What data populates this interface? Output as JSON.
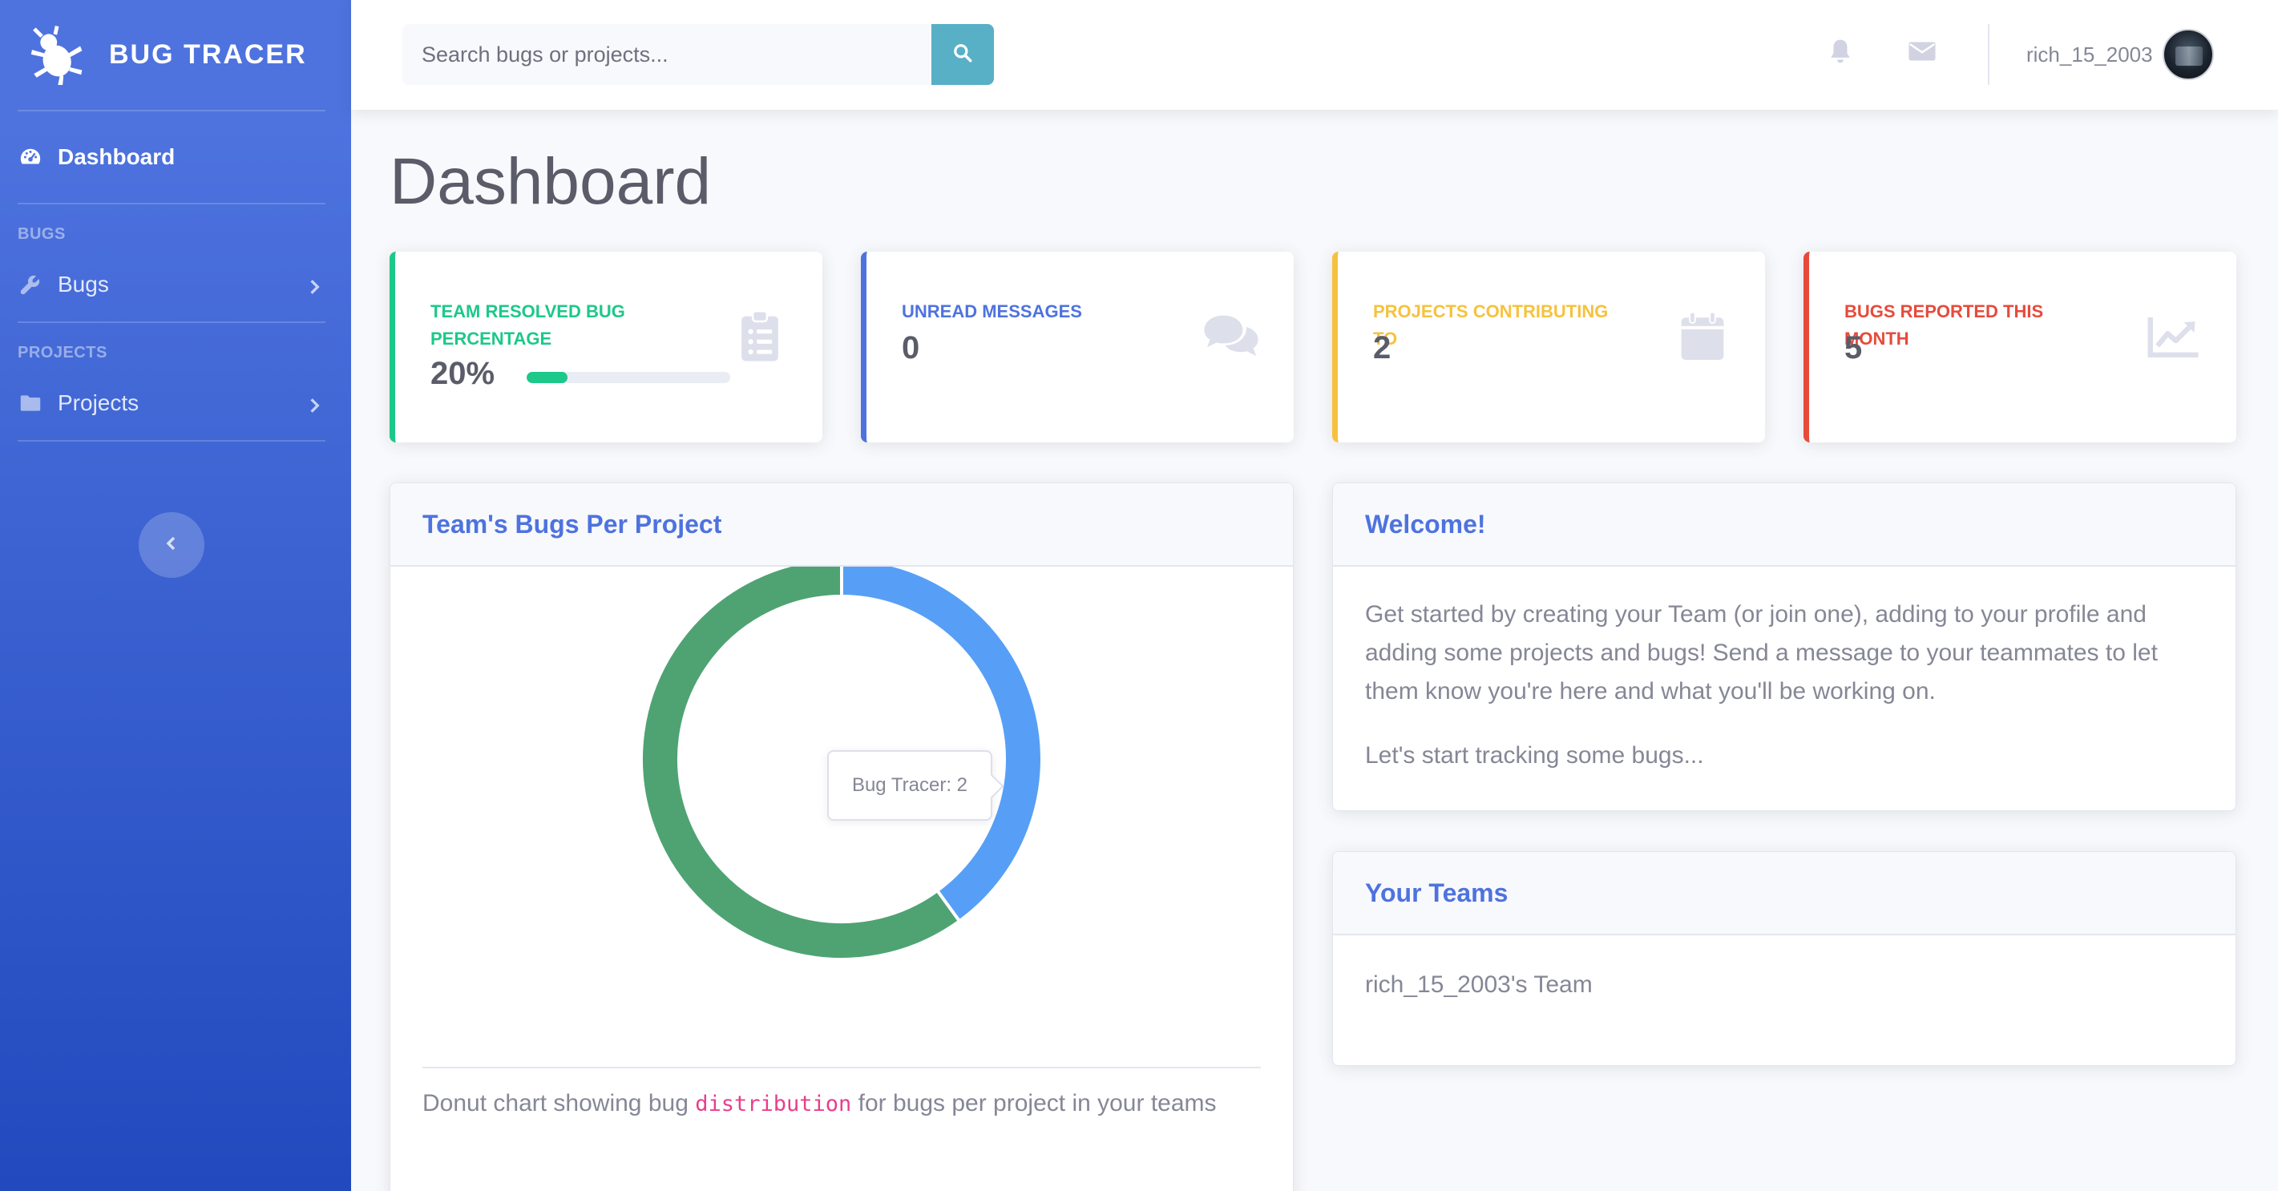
{
  "app": {
    "brand": "BUG TRACER"
  },
  "sidebar": {
    "dashboard_label": "Dashboard",
    "bugs_heading": "BUGS",
    "bugs_label": "Bugs",
    "projects_heading": "PROJECTS",
    "projects_label": "Projects"
  },
  "topbar": {
    "search_placeholder": "Search bugs or projects...",
    "username": "rich_15_2003"
  },
  "page": {
    "title": "Dashboard"
  },
  "stats": [
    {
      "title": "TEAM RESOLVED BUG PERCENTAGE",
      "value": "20%",
      "progress": 0.2,
      "color": "#1cc88a",
      "icon": "clipboard-list-icon"
    },
    {
      "title": "UNREAD MESSAGES",
      "value": "0",
      "color": "#4e73df",
      "icon": "comments-icon"
    },
    {
      "title": "PROJECTS CONTRIBUTING TO",
      "value": "2",
      "color": "#f6c23e",
      "icon": "calendar-icon"
    },
    {
      "title": "BUGS REPORTED THIS MONTH",
      "value": "5",
      "color": "#e74a3b",
      "icon": "chart-line-icon"
    }
  ],
  "chart_panel": {
    "title": "Team's Bugs Per Project",
    "tooltip": "Bug Tracer: 2",
    "caption_before": "Donut chart showing bug ",
    "caption_code": "distribution",
    "caption_after": " for bugs per project in your teams"
  },
  "chart_data": {
    "type": "pie",
    "categories": [
      "Bug Tracer",
      ""
    ],
    "values": [
      2,
      3
    ],
    "colors": [
      "#579ff6",
      "#4fa373"
    ],
    "donut": true
  },
  "welcome_panel": {
    "title": "Welcome!",
    "paragraph1": "Get started by creating your Team (or join one), adding to your profile and adding some projects and bugs! Send a message to your teammates to let them know you're here and what you'll be working on.",
    "paragraph2": "Let's start tracking some bugs..."
  },
  "teams_panel": {
    "title": "Your Teams",
    "teams": [
      "rich_15_2003's Team"
    ]
  }
}
